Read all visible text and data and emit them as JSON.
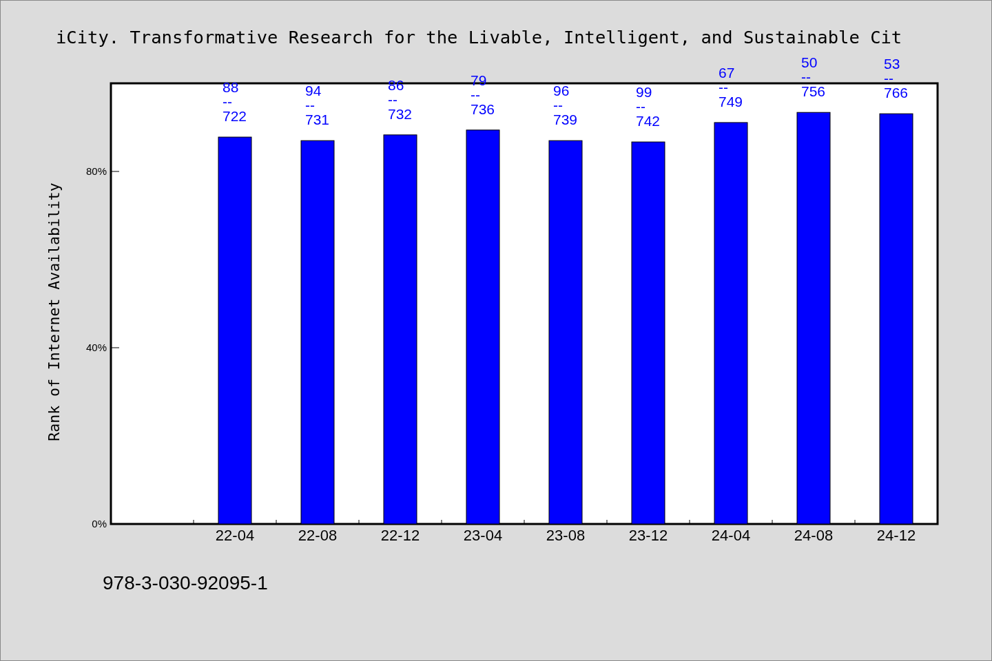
{
  "chart_data": {
    "type": "bar",
    "title": "iCity. Transformative Research for the Livable, Intelligent, and Sustainable Cit",
    "ylabel": "Rank of Internet Availability",
    "categories": [
      "22-04",
      "22-08",
      "22-12",
      "23-04",
      "23-08",
      "23-12",
      "24-04",
      "24-08",
      "24-12"
    ],
    "values": [
      87.8,
      87.0,
      88.3,
      89.4,
      87.0,
      86.7,
      91.1,
      93.4,
      93.1
    ],
    "ylim": [
      0,
      100
    ],
    "yticks": [
      {
        "value": 0,
        "label": "0%"
      },
      {
        "value": 40,
        "label": "40%"
      },
      {
        "value": 80,
        "label": "80%"
      }
    ],
    "annotations": [
      "88\n--\n722",
      "94\n--\n731",
      "86\n--\n732",
      "79\n--\n736",
      "96\n--\n739",
      "99\n--\n742",
      "67\n--\n749",
      "50\n--\n756",
      "53\n--\n766"
    ]
  },
  "footer_text": "978-3-030-92095-1"
}
